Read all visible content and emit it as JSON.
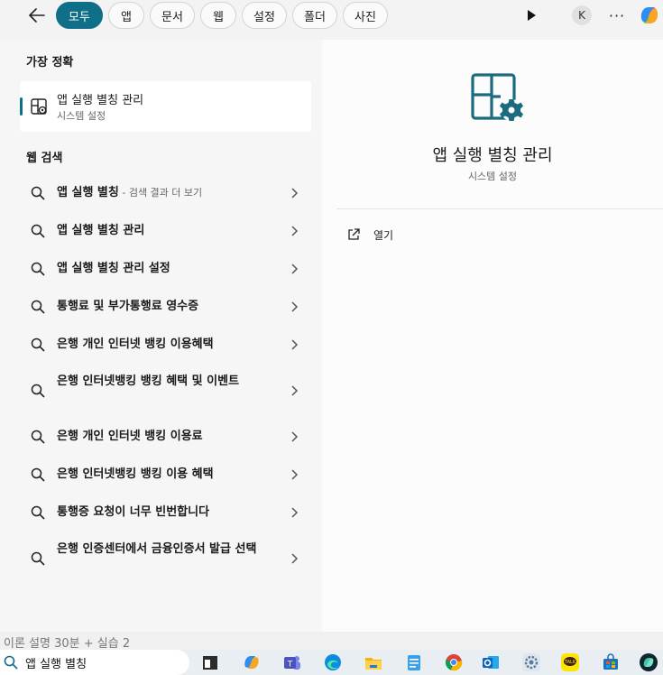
{
  "topbar": {
    "back_icon": "back-arrow-icon",
    "filters": [
      {
        "label": "모두",
        "active": true
      },
      {
        "label": "앱",
        "active": false
      },
      {
        "label": "문서",
        "active": false
      },
      {
        "label": "웹",
        "active": false
      },
      {
        "label": "설정",
        "active": false
      },
      {
        "label": "폴더",
        "active": false
      },
      {
        "label": "사진",
        "active": false
      }
    ],
    "play_icon": "play-icon",
    "avatar_initial": "K",
    "more_label": "···",
    "copilot_icon": "copilot-icon"
  },
  "best_match": {
    "section_title": "가장 정확",
    "title": "앱 실행 별칭 관리",
    "subtitle": "시스템 설정",
    "icon": "app-settings-icon"
  },
  "web_search": {
    "section_title": "웹 검색",
    "items": [
      {
        "text": "앱 실행 별칭",
        "suffix": " - 검색 결과 더 보기"
      },
      {
        "text": "앱 실행 별칭 관리",
        "suffix": ""
      },
      {
        "text": "앱 실행 별칭 관리 설정",
        "suffix": ""
      },
      {
        "text": "통행료 및 부가통행료 영수증",
        "suffix": ""
      },
      {
        "text": "은행 개인 인터넷 뱅킹 이용혜택",
        "suffix": ""
      },
      {
        "text": "은행 인터넷뱅킹 뱅킹 혜택 및 이벤트",
        "suffix": ""
      },
      {
        "text": "은행 개인 인터넷 뱅킹 이용료",
        "suffix": ""
      },
      {
        "text": "은행 인터넷뱅킹 뱅킹 이용 혜택",
        "suffix": ""
      },
      {
        "text": "통행증 요청이 너무 빈번합니다",
        "suffix": ""
      },
      {
        "text": "은행 인증센터에서 금융인증서 발급 선택",
        "suffix": ""
      }
    ]
  },
  "preview": {
    "title": "앱 실행 별칭 관리",
    "subtitle": "시스템 설정",
    "open_label": "열기",
    "open_icon": "open-external-icon"
  },
  "background": {
    "text": "이론 설명 30분 + 실습 2"
  },
  "taskbar": {
    "search_value": "앱 실행 별칭",
    "apps": [
      "terminal-icon",
      "copilot-icon",
      "teams-icon",
      "edge-icon",
      "file-explorer-icon",
      "notepad-icon",
      "chrome-icon",
      "outlook-icon",
      "settings-gear-icon",
      "kakaotalk-icon",
      "store-icon",
      "copilot-icon"
    ]
  },
  "colors": {
    "accent": "#0f6f88",
    "icon_teal": "#1a6b7e"
  }
}
